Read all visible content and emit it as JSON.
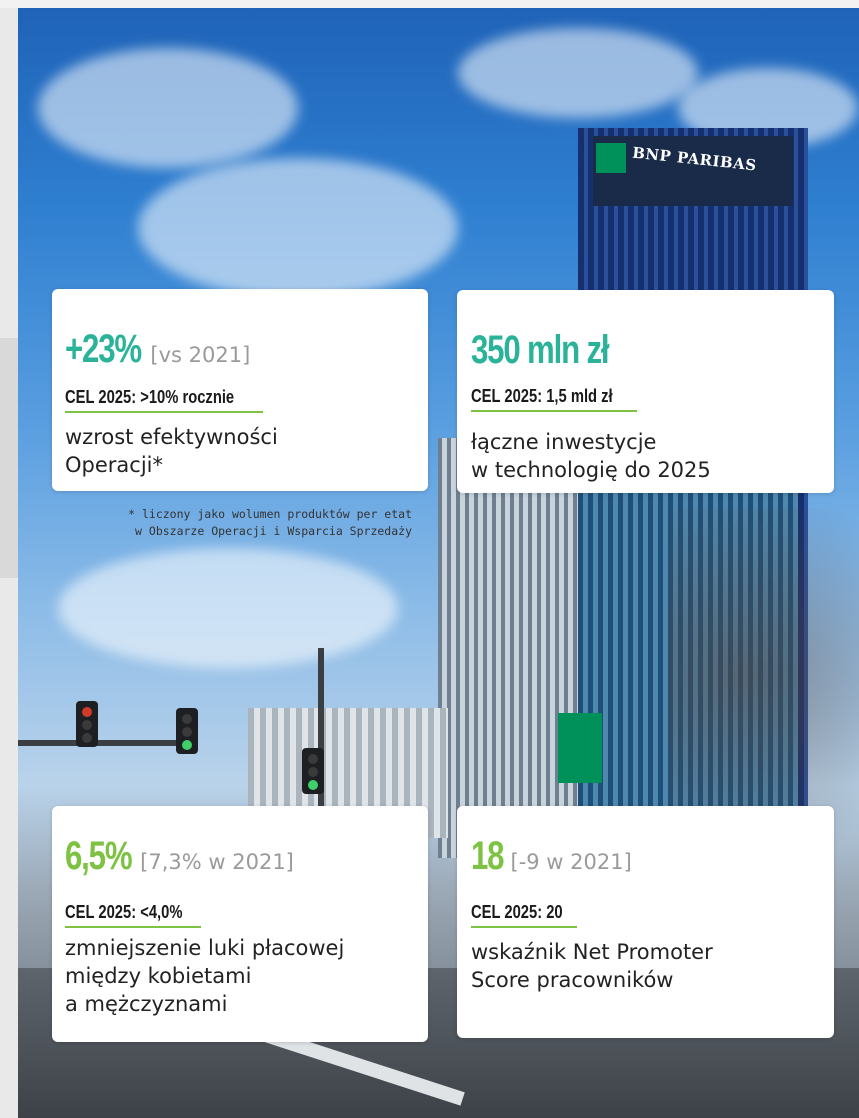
{
  "background": {
    "logo_text": "BNP PARIBAS",
    "colors": {
      "brand_green": "#00915a",
      "sky": "#2f7fd1"
    }
  },
  "cards": [
    {
      "value": "+23%",
      "comparison": "[vs 2021]",
      "goal": "CEL 2025:  >10% rocznie",
      "description": "wzrost efektywności\nOperacji*",
      "value_color": "#2bb39a"
    },
    {
      "value": "350 mln zł",
      "comparison": "",
      "goal": "CEL 2025:  1,5 mld zł",
      "description": "łączne inwestycje\nw technologię do 2025",
      "value_color": "#2bb39a"
    },
    {
      "value": "6,5%",
      "comparison": "[7,3% w 2021]",
      "goal": "CEL 2025:  <4,0%",
      "description": "zmniejszenie luki płacowej\nmiędzy kobietami\na mężczyznami",
      "value_color": "#7dc242"
    },
    {
      "value": "18",
      "comparison": "[-9 w 2021]",
      "goal": "CEL 2025:  20",
      "description": "wskaźnik Net Promoter\nScore pracowników",
      "value_color": "#7dc242"
    }
  ],
  "footnote": "* liczony jako wolumen produktów per etat\nw Obszarze Operacji i Wsparcia Sprzedaży"
}
